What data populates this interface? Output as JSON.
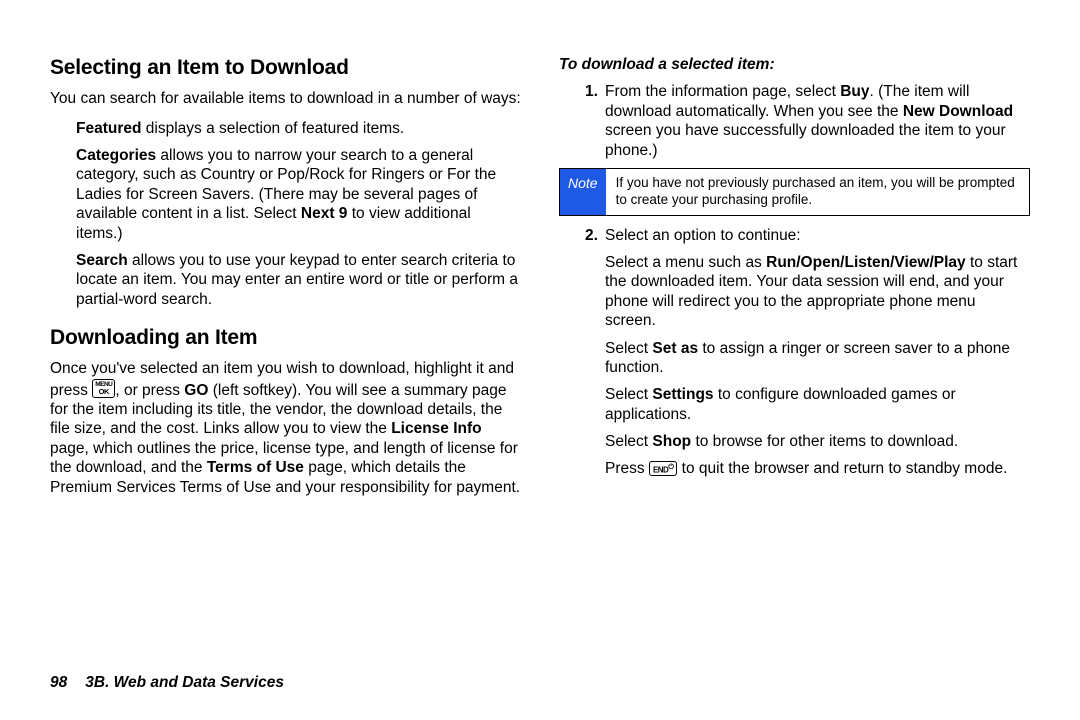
{
  "left": {
    "h_select": "Selecting an Item to Download",
    "p_intro": "You can search for available items to download in a number of ways:",
    "b_featured": "Featured",
    "p_featured_rest": " displays a selection of featured items.",
    "b_categories": "Categories",
    "p_categories_rest_a": " allows you to narrow your search to a general category, such as Country or Pop/Rock for Ringers or For the Ladies for Screen Savers. (There may be several pages of available content in a list. Select ",
    "b_next9": "Next 9",
    "p_categories_rest_b": " to view additional items.)",
    "b_search": "Search",
    "p_search_rest": " allows you to use your keypad to enter search criteria to locate an item. You may enter an entire word or title or perform a partial-word search.",
    "h_download": "Downloading an Item",
    "p_dl_a": "Once you've selected an item you wish to download, highlight it and press ",
    "p_dl_b": ", or press ",
    "b_go": "GO",
    "p_dl_c": " (left softkey). You will see a summary page for the item including its title, the vendor, the download details, the file size, and the cost. Links allow you to view the ",
    "b_license": "License Info",
    "p_dl_d": " page, which outlines the price, license type, and length of license for the download, and the ",
    "b_terms": "Terms of Use",
    "p_dl_e": " page, which details the Premium Services Terms of Use and your responsibility for payment."
  },
  "right": {
    "subhead": "To download a selected item:",
    "num1": "1.",
    "s1_a": "From the information page, select ",
    "b_buy": "Buy",
    "s1_b": ". (The item will download automatically. When you see the ",
    "b_newdl": "New Download",
    "s1_c": " screen you have successfully downloaded the item to your phone.)",
    "note_label": "Note",
    "note_text": "If you have not previously purchased an item, you will be prompted to create your purchasing profile.",
    "num2": "2.",
    "s2": "Select an option to continue:",
    "opt1_a": "Select a menu such as ",
    "b_run": "Run/Open/Listen/View/Play",
    "opt1_b": " to start the downloaded item. Your data session will end, and your phone will redirect you to the appropriate phone menu screen.",
    "opt2_a": "Select ",
    "b_setas": "Set as",
    "opt2_b": " to assign a ringer or screen saver to a phone function.",
    "opt3_a": "Select ",
    "b_settings": "Settings",
    "opt3_b": " to configure downloaded games or applications.",
    "opt4_a": "Select ",
    "b_shop": "Shop",
    "opt4_b": " to browse for other items to download.",
    "opt5_a": "Press ",
    "opt5_b": " to quit the browser and return to standby mode."
  },
  "keys": {
    "menu_top": "MENU",
    "menu_bot": "OK",
    "end": "END",
    "end_sym": "⏻"
  },
  "footer": {
    "page": "98",
    "section": "3B. Web and Data Services"
  }
}
